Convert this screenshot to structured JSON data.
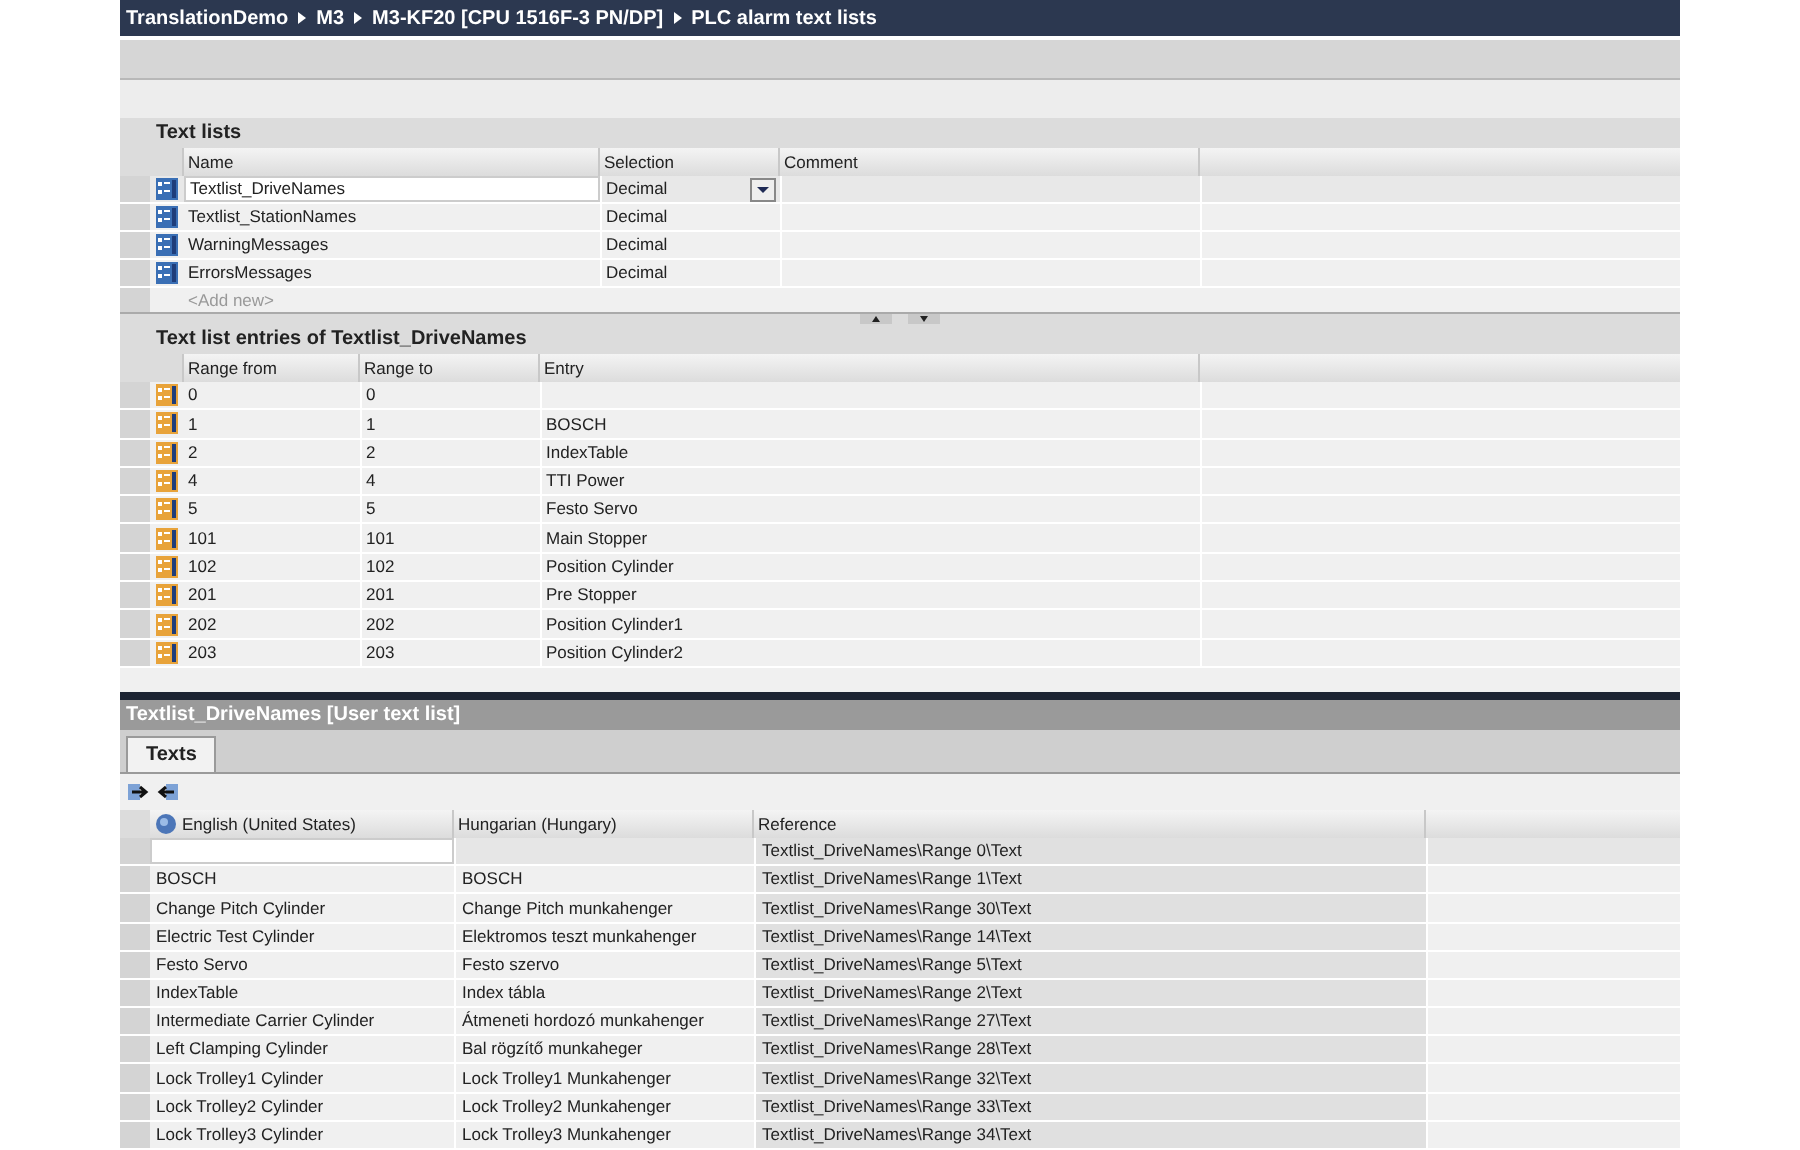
{
  "breadcrumb": [
    "TranslationDemo",
    "M3",
    "M3-KF20 [CPU 1516F-3 PN/DP]",
    "PLC alarm text lists"
  ],
  "text_lists": {
    "title": "Text lists",
    "columns": [
      "Name",
      "Selection",
      "Comment"
    ],
    "rows": [
      {
        "name": "Textlist_DriveNames",
        "selection": "Decimal",
        "selected": true
      },
      {
        "name": "Textlist_StationNames",
        "selection": "Decimal",
        "selected": false
      },
      {
        "name": "WarningMessages",
        "selection": "Decimal",
        "selected": false
      },
      {
        "name": "ErrorsMessages",
        "selection": "Decimal",
        "selected": false
      }
    ],
    "add_new": "<Add new>"
  },
  "entries": {
    "title": "Text list entries of Textlist_DriveNames",
    "columns": [
      "Range from",
      "Range to",
      "Entry"
    ],
    "rows": [
      [
        "0",
        "0",
        ""
      ],
      [
        "1",
        "1",
        "BOSCH"
      ],
      [
        "2",
        "2",
        "IndexTable"
      ],
      [
        "4",
        "4",
        "TTI Power"
      ],
      [
        "5",
        "5",
        "Festo Servo"
      ],
      [
        "101",
        "101",
        "Main Stopper"
      ],
      [
        "102",
        "102",
        "Position Cylinder"
      ],
      [
        "201",
        "201",
        "Pre Stopper"
      ],
      [
        "202",
        "202",
        "Position Cylinder1"
      ],
      [
        "203",
        "203",
        "Position Cylinder2"
      ]
    ]
  },
  "inspector": {
    "title": "Textlist_DriveNames [User text list]",
    "tabs": [
      {
        "label": "Texts",
        "selected": true
      }
    ],
    "columns": [
      "English (United States)",
      "Hungarian (Hungary)",
      "Reference"
    ],
    "rows": [
      {
        "english": "",
        "hungarian": "",
        "reference": "Textlist_DriveNames\\Range 0\\Text",
        "selected": true
      },
      {
        "english": "BOSCH",
        "hungarian": "BOSCH",
        "reference": "Textlist_DriveNames\\Range 1\\Text",
        "selected": false
      },
      {
        "english": "Change Pitch Cylinder",
        "hungarian": "Change Pitch munkahenger",
        "reference": "Textlist_DriveNames\\Range 30\\Text",
        "selected": false
      },
      {
        "english": "Electric Test Cylinder",
        "hungarian": "Elektromos teszt munkahenger",
        "reference": "Textlist_DriveNames\\Range 14\\Text",
        "selected": false
      },
      {
        "english": "Festo Servo",
        "hungarian": "Festo szervo",
        "reference": "Textlist_DriveNames\\Range 5\\Text",
        "selected": false
      },
      {
        "english": "IndexTable",
        "hungarian": "Index tábla",
        "reference": "Textlist_DriveNames\\Range 2\\Text",
        "selected": false
      },
      {
        "english": "Intermediate Carrier Cylinder",
        "hungarian": "Átmeneti hordozó munkahenger",
        "reference": "Textlist_DriveNames\\Range 27\\Text",
        "selected": false
      },
      {
        "english": "Left Clamping Cylinder",
        "hungarian": "Bal rögzítő munkaheger",
        "reference": "Textlist_DriveNames\\Range 28\\Text",
        "selected": false
      },
      {
        "english": "Lock Trolley1 Cylinder",
        "hungarian": "Lock Trolley1 Munkahenger",
        "reference": "Textlist_DriveNames\\Range 32\\Text",
        "selected": false
      },
      {
        "english": "Lock Trolley2 Cylinder",
        "hungarian": "Lock Trolley2 Munkahenger",
        "reference": "Textlist_DriveNames\\Range 33\\Text",
        "selected": false
      },
      {
        "english": "Lock Trolley3 Cylinder",
        "hungarian": "Lock Trolley3 Munkahenger",
        "reference": "Textlist_DriveNames\\Range 34\\Text",
        "selected": false
      }
    ]
  }
}
